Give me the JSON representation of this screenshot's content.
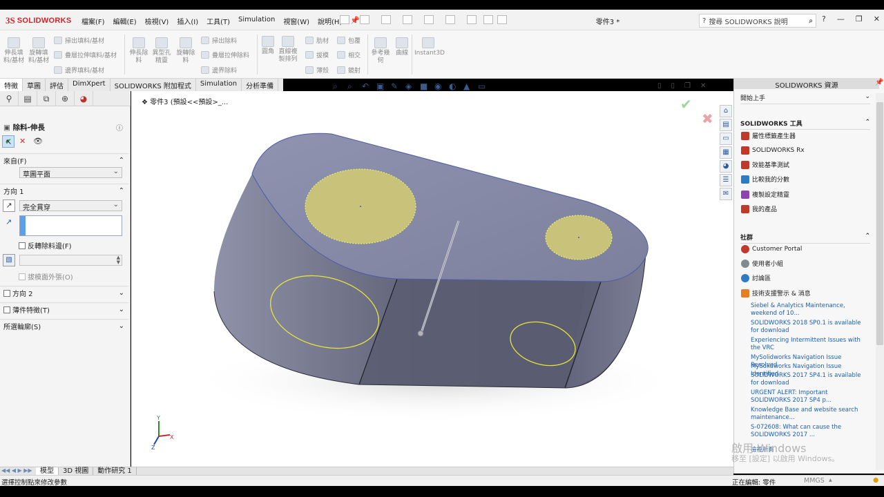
{
  "app": {
    "brand_ds": "3S",
    "brand_name": "SOLIDWORKS",
    "document_title": "零件3 *"
  },
  "menus": [
    "檔案(F)",
    "編輯(E)",
    "檢視(V)",
    "插入(I)",
    "工具(T)",
    "Simulation",
    "視窗(W)",
    "說明(H)"
  ],
  "search": {
    "placeholder": "搜尋 SOLIDWORKS 說明"
  },
  "command_manager": {
    "big_buttons": [
      "伸長填料/基材",
      "旋轉填料/基材",
      "伸長除料",
      "異型孔精靈",
      "旋轉除料",
      "圓角",
      "直線複製排列",
      "參考幾何",
      "曲線",
      "Instant3D"
    ],
    "small_buttons": [
      "掃出填料/基材",
      "疊層拉伸填料/基材",
      "邊界填料/基材",
      "掃出除料",
      "疊層拉伸除料",
      "邊界除料",
      "肋材",
      "拔模",
      "薄殼",
      "包覆",
      "相交",
      "鏡射"
    ]
  },
  "tabs": [
    {
      "label": "特徵",
      "active": true
    },
    {
      "label": "草圖",
      "active": false
    },
    {
      "label": "評估",
      "active": false
    },
    {
      "label": "DimXpert",
      "active": false
    },
    {
      "label": "SOLIDWORKS 附加程式",
      "active": false
    },
    {
      "label": "Simulation",
      "active": false
    },
    {
      "label": "分析準備",
      "active": false
    }
  ],
  "breadcrumb": "零件3 (預設<<預設>_...",
  "property_manager": {
    "title": "除料-伸長",
    "from_label": "來自(F)",
    "from_value": "草圖平面",
    "direction1_label": "方向 1",
    "end_condition": "完全貫穿",
    "flip_label": "反轉除料邊(F)",
    "draft_label": "拔模面外張(O)",
    "direction2_label": "方向 2",
    "thin_label": "薄件特徵(T)",
    "contours_label": "所選輪廓(S)"
  },
  "task_pane": {
    "title": "SOLIDWORKS 資源",
    "getting_started": "開始上手",
    "tools_header": "SOLIDWORKS 工具",
    "tools": [
      "屬性標籤產生器",
      "SOLIDWORKS Rx",
      "效能基準測試",
      "比較我的分數",
      "複製設定精靈",
      "我的產品"
    ],
    "community_header": "社群",
    "community": [
      "Customer Portal",
      "使用者小組",
      "討論區",
      "技術支援警示 & 消息"
    ],
    "news": [
      "Siebel & Analytics Maintenance, weekend of 10...",
      "SOLIDWORKS 2018 SP0.1 is available for download",
      "Experiencing Intermittent Issues with the VRC",
      "MySolidworks Navigation Issue Resolved",
      "MySolidworks Navigation Issue Identified",
      "SOLIDWORKS 2017 SP4.1 is available for download",
      "URGENT ALERT: Important SOLIDWORKS 2017 SP4 p...",
      "Knowledge Base and website search maintenance...",
      "S-072608: What can cause the SOLIDWORKS 2017 ...",
      "檢視所有"
    ]
  },
  "bottom_tabs": [
    {
      "label": "模型",
      "active": true
    },
    {
      "label": "3D 視圖",
      "active": false
    },
    {
      "label": "動作研究 1",
      "active": false
    }
  ],
  "status": {
    "hint": "選擇控制點來修改參數",
    "editing": "正在編輯: 零件",
    "units": "MMGS"
  },
  "watermark": {
    "line1": "啟用 Windows",
    "line2": "移至 [設定] 以啟用 Windows。"
  },
  "triad": {
    "x": "X",
    "y": "Y",
    "z": "Z"
  },
  "colors": {
    "brand": "#d2232a",
    "model_face": "#7c7f99",
    "sketch_fill": "#c8c27a",
    "selection_yellow": "#e8e04a"
  }
}
